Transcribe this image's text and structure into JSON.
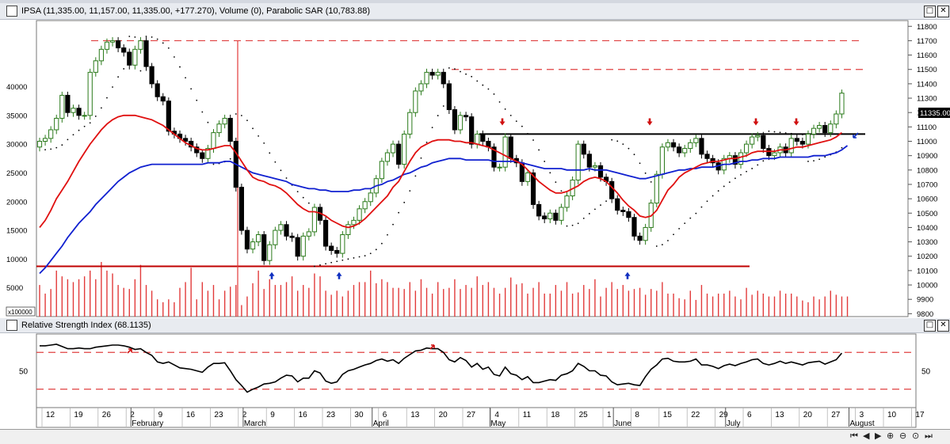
{
  "price_panel": {
    "title": "IPSA (11,335.00, 11,157.00, 11,335.00, +177.270), Volume (0), Parabolic SAR (10,783.88)",
    "last_price_label": "11335.00",
    "volume_multiplier_label": "x100000"
  },
  "rsi_panel": {
    "title": "Relative Strength Index (68.1135)"
  },
  "window_buttons": {
    "restore": "□",
    "close": "✕"
  },
  "colors": {
    "up_candle": "#2a7a1a",
    "down_candle": "#000000",
    "volume": "#e23a3a",
    "sma_fast": "#e01010",
    "sma_slow": "#1020d0",
    "sar": "#000000",
    "support_line": "#c00000",
    "resistance_dashed": "#e04040",
    "arrow_up": "#1030c0",
    "arrow_down": "#d01010"
  },
  "nav_icons": [
    "left-end",
    "left",
    "right",
    "zoom-in",
    "zoom-out",
    "reset",
    "right-end"
  ],
  "chart_data": [
    {
      "type": "candlestick",
      "title": "IPSA",
      "y_axis_right": {
        "ticks": [
          9800,
          9900,
          10000,
          10100,
          10200,
          10300,
          10400,
          10500,
          10600,
          10700,
          10800,
          10900,
          11000,
          11100,
          11200,
          11300,
          11400,
          11500,
          11600,
          11700,
          11800
        ],
        "range": [
          9780,
          11840
        ]
      },
      "y_axis_left_volume": {
        "ticks": [
          5000,
          10000,
          15000,
          20000,
          25000,
          30000,
          35000,
          40000
        ],
        "range": [
          0,
          51500
        ],
        "unit_label": "x100000"
      },
      "x_tick_labels": [
        "12",
        "19",
        "26",
        "2",
        "9",
        "16",
        "23",
        "2",
        "9",
        "16",
        "23",
        "30",
        "6",
        "13",
        "20",
        "27",
        "4",
        "11",
        "18",
        "25",
        "1",
        "8",
        "15",
        "22",
        "29",
        "6",
        "13",
        "20",
        "27",
        "3",
        "10",
        "17"
      ],
      "month_labels": [
        "February",
        "March",
        "April",
        "May",
        "June",
        "July",
        "August"
      ],
      "close": [
        11000,
        11020,
        11080,
        11160,
        11320,
        11200,
        11230,
        11180,
        11180,
        11480,
        11560,
        11640,
        11690,
        11700,
        11650,
        11620,
        11530,
        11640,
        11700,
        11520,
        11400,
        11310,
        11280,
        11070,
        11050,
        11020,
        11000,
        10960,
        10920,
        10880,
        10950,
        11060,
        11120,
        11160,
        11000,
        10680,
        10380,
        10250,
        10300,
        10350,
        10170,
        10280,
        10380,
        10420,
        10340,
        10330,
        10200,
        10340,
        10370,
        10540,
        10450,
        10270,
        10240,
        10220,
        10350,
        10420,
        10450,
        10530,
        10580,
        10640,
        10740,
        10860,
        10920,
        10980,
        10840,
        11050,
        11200,
        11350,
        11400,
        11480,
        11460,
        11480,
        11400,
        11220,
        11080,
        11180,
        11170,
        10980,
        11050,
        11000,
        10960,
        10820,
        10820,
        11030,
        10880,
        10850,
        10720,
        10780,
        10560,
        10480,
        10460,
        10500,
        10450,
        10540,
        10620,
        10730,
        10980,
        10910,
        10820,
        10830,
        10750,
        10720,
        10600,
        10520,
        10510,
        10470,
        10340,
        10310,
        10400,
        10570,
        10770,
        10960,
        10990,
        10960,
        10920,
        10950,
        10990,
        11020,
        10910,
        10880,
        10850,
        10800,
        10880,
        10900,
        10840,
        10920,
        10980,
        11030,
        11040,
        10950,
        10900,
        10920,
        10960,
        10920,
        11020,
        11000,
        10980,
        11050,
        11090,
        11110,
        11060,
        11120,
        11190,
        11335
      ],
      "volume_x100000": [
        5500,
        4000,
        4800,
        8000,
        7000,
        6500,
        6000,
        6500,
        7000,
        8000,
        6500,
        9500,
        8000,
        7500,
        5500,
        5000,
        4800,
        6500,
        9000,
        5500,
        4500,
        3000,
        2500,
        3000,
        2500,
        5000,
        6000,
        8500,
        3000,
        6000,
        4500,
        5500,
        3000,
        4500,
        5200,
        5500,
        2000,
        3500,
        5800,
        8000,
        4800,
        6500,
        5500,
        5500,
        6000,
        7000,
        4500,
        5500,
        5000,
        7500,
        7000,
        4500,
        3800,
        4500,
        3500,
        4500,
        5500,
        6000,
        6000,
        8000,
        5800,
        6500,
        6000,
        5000,
        5000,
        4800,
        6000,
        4500,
        6500,
        5000,
        4000,
        6000,
        4800,
        5000,
        6500,
        4800,
        5500,
        5000,
        7000,
        5500,
        6000,
        5000,
        4000,
        5000,
        6800,
        5600,
        5800,
        4000,
        5000,
        6000,
        4000,
        4000,
        5500,
        4500,
        6000,
        4000,
        4200,
        5500,
        4800,
        6500,
        3500,
        5000,
        6000,
        4800,
        5500,
        4500,
        4800,
        5000,
        3800,
        4800,
        4500,
        6000,
        4000,
        4000,
        3200,
        3000,
        4500,
        2900,
        5500,
        4000,
        3500,
        4000,
        4000,
        4500,
        3500,
        3000,
        5000,
        3800,
        4500,
        4000,
        3500,
        3500,
        4500,
        4000,
        4000,
        3500,
        2800,
        2500,
        3500,
        3000,
        3500,
        4500,
        3800,
        3500,
        3500
      ],
      "sma_fast": [
        10400,
        10450,
        10520,
        10600,
        10660,
        10720,
        10790,
        10860,
        10920,
        10980,
        11030,
        11080,
        11120,
        11150,
        11170,
        11180,
        11180,
        11180,
        11170,
        11160,
        11150,
        11130,
        11110,
        11080,
        11050,
        11020,
        10990,
        10970,
        10950,
        10940,
        10940,
        10950,
        10960,
        10970,
        10970,
        10920,
        10860,
        10800,
        10750,
        10730,
        10720,
        10700,
        10690,
        10670,
        10640,
        10600,
        10560,
        10530,
        10510,
        10510,
        10500,
        10480,
        10450,
        10430,
        10410,
        10400,
        10410,
        10430,
        10460,
        10500,
        10540,
        10580,
        10620,
        10680,
        10720,
        10790,
        10860,
        10920,
        10960,
        10980,
        11000,
        11010,
        11010,
        11010,
        11000,
        11000,
        10990,
        10990,
        10980,
        10970,
        10960,
        10940,
        10920,
        10900,
        10880,
        10860,
        10840,
        10800,
        10760,
        10720,
        10690,
        10660,
        10640,
        10640,
        10650,
        10670,
        10690,
        10720,
        10740,
        10750,
        10740,
        10720,
        10680,
        10640,
        10590,
        10550,
        10520,
        10480,
        10470,
        10480,
        10520,
        10590,
        10660,
        10700,
        10750,
        10780,
        10800,
        10820,
        10840,
        10850,
        10860,
        10860,
        10870,
        10880,
        10880,
        10890,
        10900,
        10920,
        10930,
        10930,
        10930,
        10930,
        10940,
        10940,
        10950,
        10960,
        10960,
        10970,
        10980,
        10990,
        11000,
        11010,
        11030,
        11060
      ],
      "sma_slow": [
        10080,
        10120,
        10170,
        10220,
        10270,
        10330,
        10380,
        10430,
        10470,
        10510,
        10560,
        10600,
        10640,
        10680,
        10720,
        10750,
        10780,
        10800,
        10820,
        10830,
        10840,
        10840,
        10840,
        10840,
        10840,
        10840,
        10840,
        10840,
        10840,
        10840,
        10850,
        10850,
        10850,
        10860,
        10860,
        10840,
        10820,
        10800,
        10780,
        10770,
        10760,
        10750,
        10740,
        10730,
        10720,
        10700,
        10690,
        10680,
        10670,
        10670,
        10660,
        10660,
        10650,
        10650,
        10650,
        10650,
        10660,
        10660,
        10670,
        10670,
        10690,
        10700,
        10720,
        10730,
        10750,
        10770,
        10780,
        10800,
        10820,
        10830,
        10850,
        10860,
        10870,
        10880,
        10880,
        10880,
        10870,
        10870,
        10870,
        10870,
        10870,
        10860,
        10860,
        10860,
        10860,
        10860,
        10850,
        10840,
        10830,
        10820,
        10810,
        10810,
        10810,
        10810,
        10800,
        10800,
        10800,
        10800,
        10810,
        10800,
        10800,
        10800,
        10790,
        10780,
        10770,
        10760,
        10750,
        10740,
        10740,
        10750,
        10760,
        10770,
        10780,
        10790,
        10800,
        10800,
        10810,
        10810,
        10820,
        10820,
        10820,
        10830,
        10840,
        10840,
        10850,
        10860,
        10860,
        10870,
        10870,
        10880,
        10880,
        10880,
        10890,
        10890,
        10890,
        10890,
        10890,
        10890,
        10900,
        10900,
        10900,
        10910,
        10920,
        10940,
        10970
      ]
    },
    {
      "type": "line",
      "title": "Relative Strength Index",
      "y_axis": {
        "ticks": [
          50
        ],
        "range": [
          0,
          100
        ],
        "overbought": 75,
        "oversold": 25
      },
      "rsi": [
        84,
        84,
        85,
        86,
        83,
        80,
        80,
        81,
        80,
        80,
        82,
        83,
        84,
        85,
        85,
        84,
        82,
        79,
        80,
        75,
        71,
        62,
        60,
        62,
        58,
        54,
        53,
        52,
        50,
        48,
        55,
        60,
        60,
        61,
        50,
        38,
        30,
        21,
        25,
        28,
        32,
        33,
        35,
        40,
        44,
        43,
        35,
        40,
        40,
        50,
        47,
        36,
        33,
        35,
        45,
        50,
        52,
        55,
        58,
        60,
        64,
        66,
        63,
        65,
        60,
        67,
        72,
        77,
        78,
        81,
        80,
        80,
        75,
        65,
        62,
        68,
        64,
        55,
        60,
        52,
        55,
        45,
        43,
        55,
        46,
        44,
        38,
        42,
        34,
        34,
        36,
        38,
        37,
        44,
        46,
        50,
        60,
        56,
        50,
        50,
        44,
        43,
        35,
        31,
        32,
        33,
        31,
        30,
        42,
        52,
        58,
        66,
        67,
        63,
        62,
        62,
        63,
        66,
        58,
        58,
        56,
        53,
        57,
        59,
        57,
        60,
        62,
        65,
        66,
        60,
        58,
        60,
        63,
        60,
        62,
        60,
        58,
        61,
        62,
        63,
        59,
        62,
        65,
        74
      ]
    }
  ]
}
